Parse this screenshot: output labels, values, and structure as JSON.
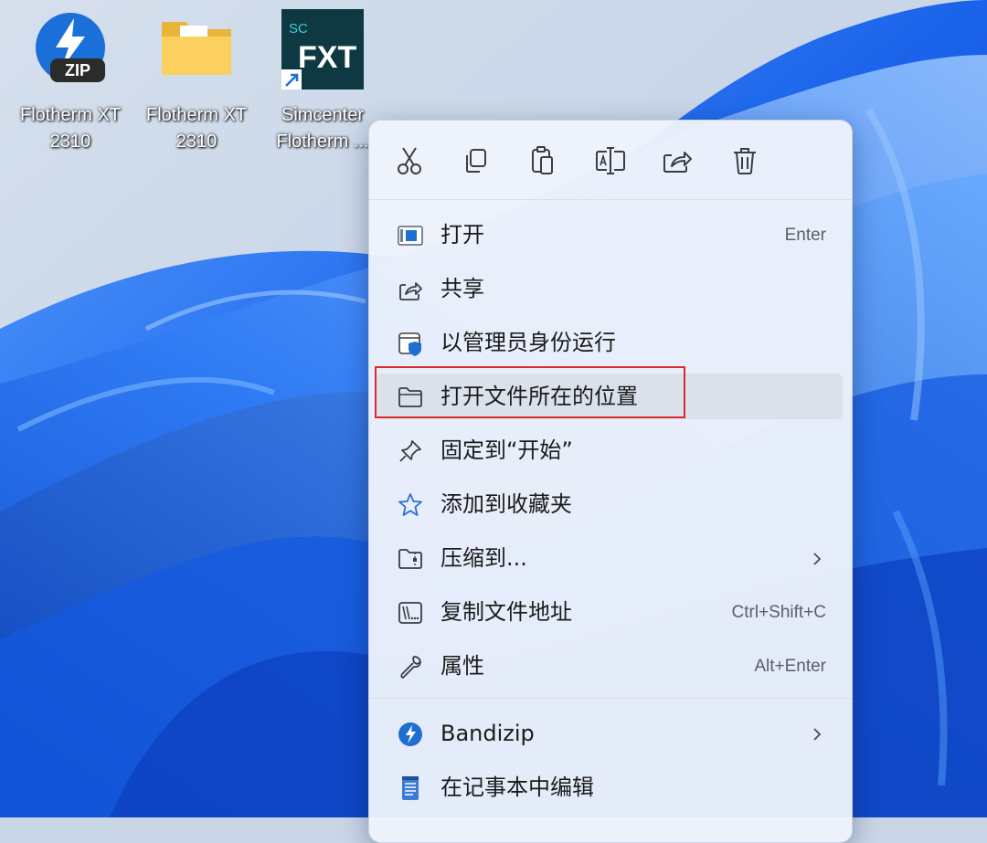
{
  "desktop": {
    "icons": [
      {
        "label_line1": "Flotherm XT",
        "label_line2": "2310",
        "icon": "bandizip-zip-icon"
      },
      {
        "label_line1": "Flotherm XT",
        "label_line2": "2310",
        "icon": "folder-icon"
      },
      {
        "label_line1": "Simcenter",
        "label_line2": "Flotherm ...",
        "icon": "simcenter-fxt-shortcut-icon",
        "badge_top": "SC",
        "badge_main": "FXT"
      }
    ],
    "zip_badge": "ZIP"
  },
  "context_menu": {
    "quick_actions": [
      {
        "name": "cut",
        "icon": "scissors-icon"
      },
      {
        "name": "copy",
        "icon": "copy-icon"
      },
      {
        "name": "paste",
        "icon": "clipboard-icon"
      },
      {
        "name": "rename",
        "icon": "rename-icon"
      },
      {
        "name": "share",
        "icon": "share-icon"
      },
      {
        "name": "delete",
        "icon": "trash-icon"
      }
    ],
    "items": [
      {
        "label": "打开",
        "shortcut": "Enter",
        "icon": "app-window-icon"
      },
      {
        "label": "共享",
        "shortcut": "",
        "icon": "share-icon"
      },
      {
        "label": "以管理员身份运行",
        "shortcut": "",
        "icon": "shield-window-icon"
      },
      {
        "label": "打开文件所在的位置",
        "shortcut": "",
        "icon": "folder-open-icon",
        "highlighted": true
      },
      {
        "label": "固定到“开始”",
        "shortcut": "",
        "icon": "pin-icon"
      },
      {
        "label": "添加到收藏夹",
        "shortcut": "",
        "icon": "star-icon"
      },
      {
        "label": "压缩到...",
        "shortcut": "",
        "icon": "zip-folder-icon",
        "submenu": true
      },
      {
        "label": "复制文件地址",
        "shortcut": "Ctrl+Shift+C",
        "icon": "copy-path-icon"
      },
      {
        "label": "属性",
        "shortcut": "Alt+Enter",
        "icon": "wrench-icon"
      },
      {
        "label": "Bandizip",
        "shortcut": "",
        "icon": "bandizip-icon",
        "submenu": true
      },
      {
        "label": "在记事本中编辑",
        "shortcut": "",
        "icon": "notepad-icon"
      }
    ]
  },
  "colors": {
    "accent": "#0067c0",
    "highlight_border": "#d9292b",
    "wallpaper_blue": "#1565e8"
  }
}
